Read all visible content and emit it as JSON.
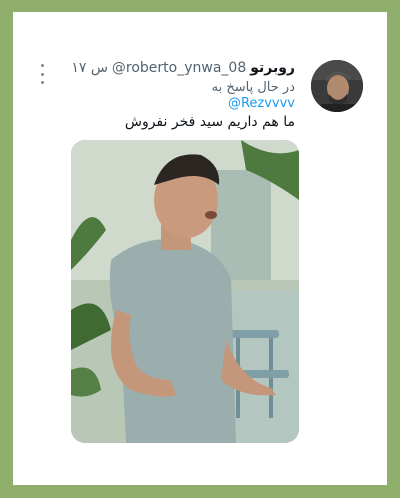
{
  "tweet": {
    "display_name": "روبرتو",
    "handle": "@roberto_ynwa_08",
    "time": "۱۷ س",
    "reply_prefix": "در حال پاسخ به",
    "reply_to": "@Rezvvvv",
    "text": "ما هم داریم سید فخر نفروش"
  },
  "icons": {
    "more": "more-vertical-icon",
    "avatar": "user-avatar"
  },
  "colors": {
    "frame": "#8fad6b",
    "link": "#1d9bf0",
    "text": "#0f1419",
    "secondary": "#536471"
  }
}
